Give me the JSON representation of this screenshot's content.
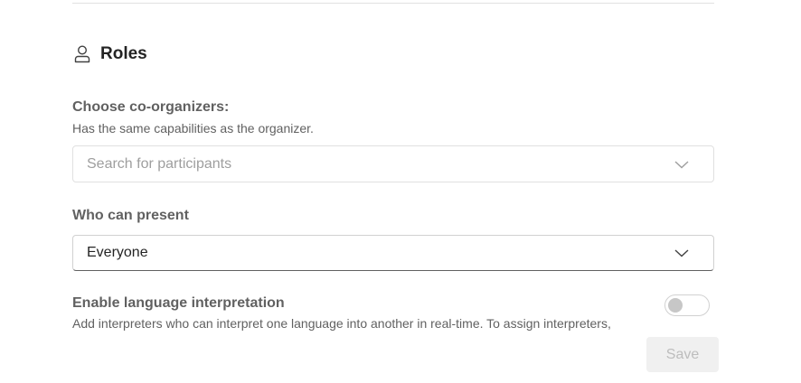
{
  "roles": {
    "title": "Roles",
    "icon": "person-icon"
  },
  "co_organizers": {
    "label": "Choose co-organizers:",
    "description": "Has the same capabilities as the organizer.",
    "placeholder": "Search for participants",
    "value": ""
  },
  "who_can_present": {
    "label": "Who can present",
    "selected": "Everyone"
  },
  "language_interpretation": {
    "label": "Enable language interpretation",
    "description": "Add interpreters who can interpret one language into another in real-time. To assign interpreters,",
    "enabled": false
  },
  "actions": {
    "save_label": "Save",
    "save_enabled": false
  },
  "colors": {
    "label_gray": "#616161",
    "text_dark": "#242424",
    "placeholder": "#9e9e9e",
    "disabled_button_bg": "#f0f0f0",
    "disabled_button_text": "#bdbdbd"
  }
}
